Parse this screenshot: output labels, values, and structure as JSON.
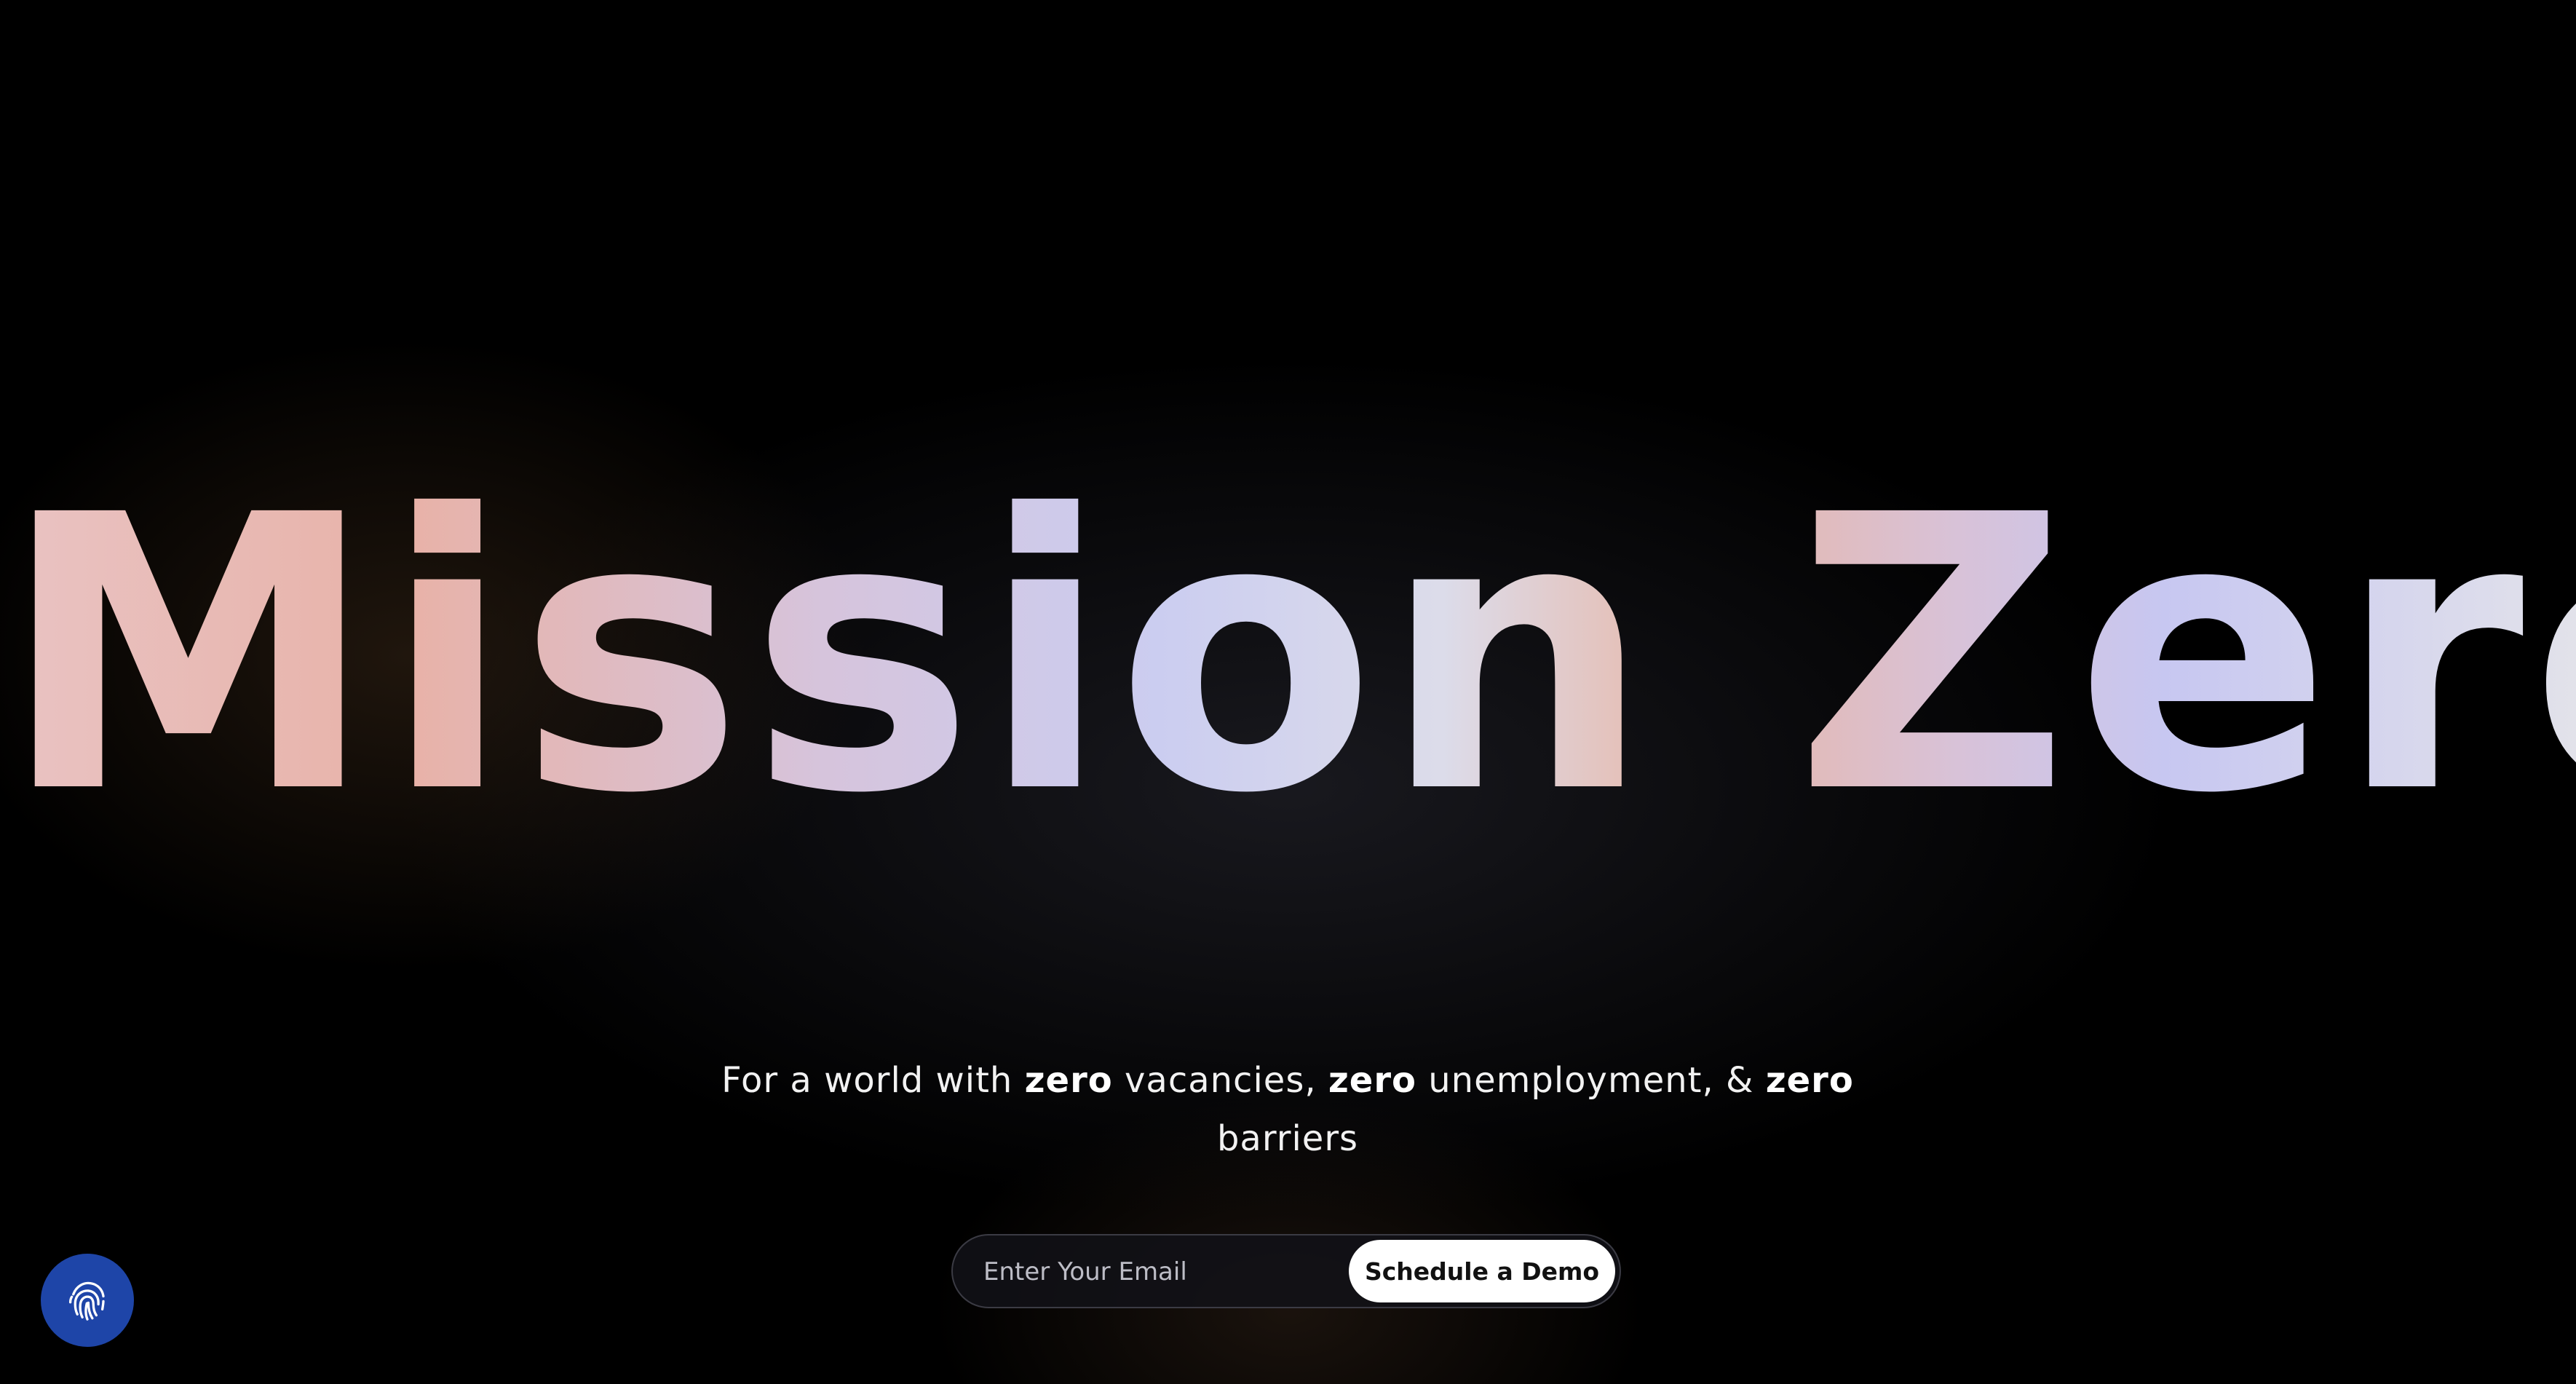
{
  "hero": {
    "title": "Mission Zero"
  },
  "tagline": {
    "part1": "For a world with ",
    "zero1": "zero",
    "part2": " vacancies, ",
    "zero2": "zero",
    "part3": " unemployment, & ",
    "zero3": "zero",
    "part4": " barriers"
  },
  "signup": {
    "email_placeholder": "Enter Your Email",
    "email_value": "",
    "button_label": "Schedule a Demo"
  },
  "floating_button": {
    "icon": "fingerprint-icon",
    "color": "#1e45a8"
  },
  "colors": {
    "background": "#000000",
    "button_background": "#ffffff",
    "button_text": "#111111"
  }
}
